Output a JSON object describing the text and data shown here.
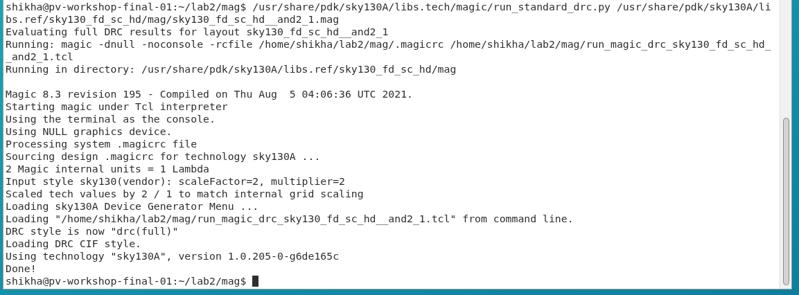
{
  "terminal": {
    "blocks": [
      {
        "lines": [
          "shikha@pv-workshop-final-01:~/lab2/mag$ /usr/share/pdk/sky130A/libs.tech/magic/run_standard_drc.py /usr/share/pdk/sky130A/li",
          "bs.ref/sky130_fd_sc_hd/mag/sky130_fd_sc_hd__and2_1.mag",
          "Evaluating full DRC results for layout sky130_fd_sc_hd__and2_1",
          "Running: magic -dnull -noconsole -rcfile /home/shikha/lab2/mag/.magicrc /home/shikha/lab2/mag/run_magic_drc_sky130_fd_sc_hd_",
          "_and2_1.tcl",
          "Running in directory: /usr/share/pdk/sky130A/libs.ref/sky130_fd_sc_hd/mag"
        ]
      },
      {
        "lines": [
          "Magic 8.3 revision 195 - Compiled on Thu Aug  5 04:06:36 UTC 2021.",
          "Starting magic under Tcl interpreter",
          "Using the terminal as the console.",
          "Using NULL graphics device.",
          "Processing system .magicrc file",
          "Sourcing design .magicrc for technology sky130A ...",
          "2 Magic internal units = 1 Lambda",
          "Input style sky130(vendor): scaleFactor=2, multiplier=2",
          "Scaled tech values by 2 / 1 to match internal grid scaling",
          "Loading sky130A Device Generator Menu ...",
          "Loading \"/home/shikha/lab2/mag/run_magic_drc_sky130_fd_sc_hd__and2_1.tcl\" from command line.",
          "DRC style is now \"drc(full)\"",
          "Loading DRC CIF style.",
          "Using technology \"sky130A\", version 1.0.205-0-g6de165c",
          "Done!"
        ]
      }
    ],
    "prompt": "shikha@pv-workshop-final-01:~/lab2/mag$"
  }
}
